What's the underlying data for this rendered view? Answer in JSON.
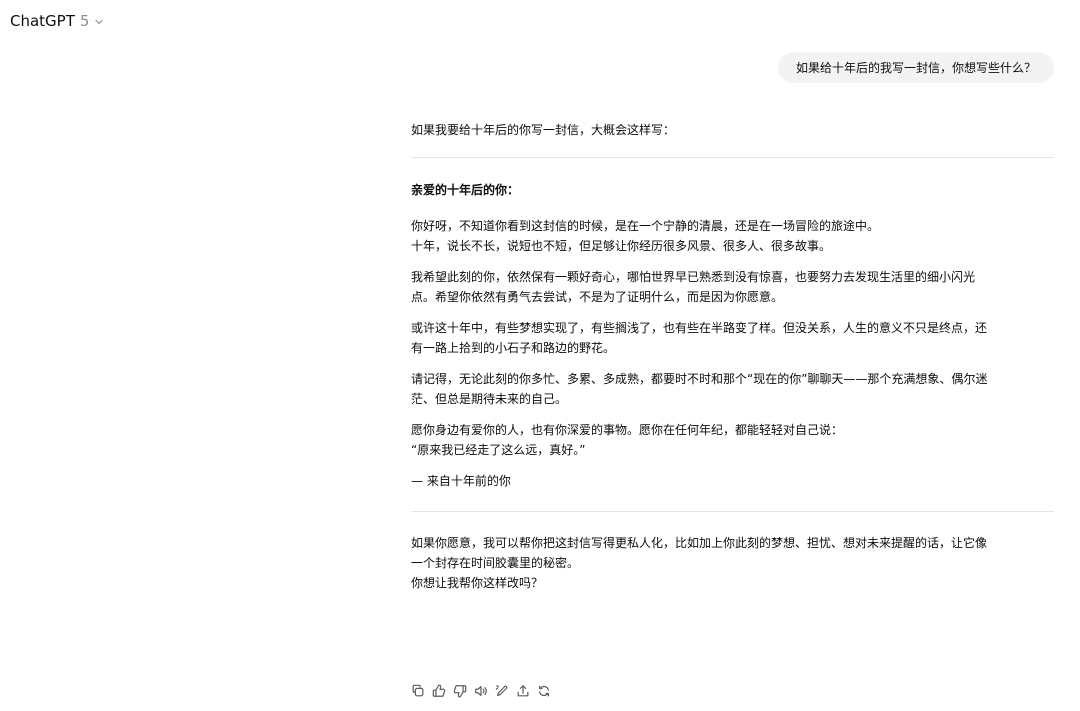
{
  "header": {
    "model_name": "ChatGPT",
    "model_version": "5"
  },
  "user_message": "如果给十年后的我写一封信，你想写些什么？",
  "assistant": {
    "intro": "如果我要给十年后的你写一封信，大概会这样写：",
    "greeting": "亲爱的十年后的你：",
    "paragraphs": [
      [
        "你好呀，不知道你看到这封信的时候，是在一个宁静的清晨，还是在一场冒险的旅途中。",
        "十年，说长不长，说短也不短，但足够让你经历很多风景、很多人、很多故事。"
      ],
      [
        "我希望此刻的你，依然保有一颗好奇心，哪怕世界早已熟悉到没有惊喜，也要努力去发现生活里的细小闪光",
        "点。希望你依然有勇气去尝试，不是为了证明什么，而是因为你愿意。"
      ],
      [
        "或许这十年中，有些梦想实现了，有些搁浅了，也有些在半路变了样。但没关系，人生的意义不只是终点，还",
        "有一路上拾到的小石子和路边的野花。"
      ],
      [
        "请记得，无论此刻的你多忙、多累、多成熟，都要时不时和那个“现在的你”聊聊天——那个充满想象、偶尔迷",
        "茫、但总是期待未来的自己。"
      ],
      [
        "愿你身边有爱你的人，也有你深爱的事物。愿你在任何年纪，都能轻轻对自己说：",
        "“原来我已经走了这么远，真好。”"
      ]
    ],
    "signoff": "— 来自十年前的你",
    "followup": [
      "如果你愿意，我可以帮你把这封信写得更私人化，比如加上你此刻的梦想、担忧、想对未来提醒的话，让它像",
      "一个封存在时间胶囊里的秘密。",
      "你想让我帮你这样改吗？"
    ]
  },
  "actions": [
    {
      "name": "copy-icon"
    },
    {
      "name": "thumbs-up-icon"
    },
    {
      "name": "thumbs-down-icon"
    },
    {
      "name": "read-aloud-icon"
    },
    {
      "name": "edit-in-canvas-icon"
    },
    {
      "name": "share-icon"
    },
    {
      "name": "regenerate-icon"
    }
  ]
}
